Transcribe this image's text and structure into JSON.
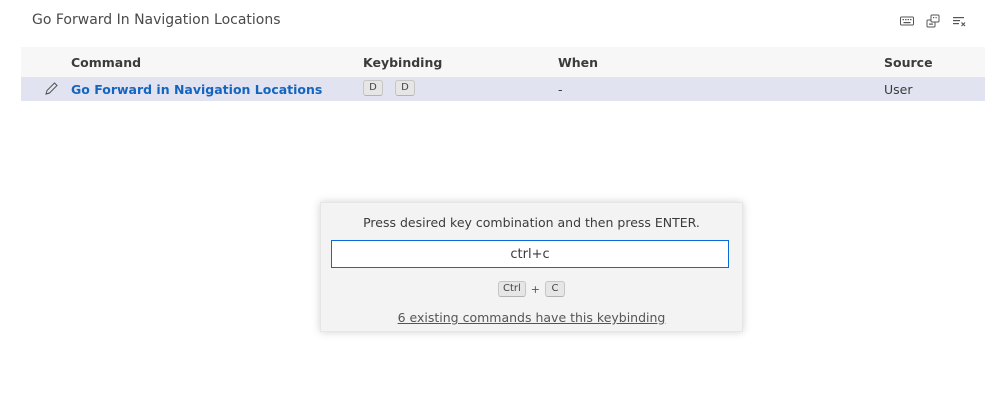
{
  "search": {
    "title": "Go Forward In Navigation Locations"
  },
  "header_actions": [
    {
      "icon": "keyboard-icon"
    },
    {
      "icon": "record-keys-icon"
    },
    {
      "icon": "clear-list-icon"
    }
  ],
  "table": {
    "headers": {
      "command": "Command",
      "keybinding": "Keybinding",
      "when": "When",
      "source": "Source"
    },
    "rows": [
      {
        "command": "Go Forward in Navigation Locations",
        "keys": [
          "D",
          "D"
        ],
        "when": "-",
        "source": "User"
      }
    ]
  },
  "dialog": {
    "message": "Press desired key combination and then press ENTER.",
    "input_value": "ctrl+c",
    "combo_keys": [
      "Ctrl",
      "C"
    ],
    "combo_separator": "+",
    "conflict_link": "6 existing commands have this keybinding"
  },
  "colors": {
    "accent": "#1565c0",
    "row_selected": "#e1e4f0",
    "input_border": "#0969da"
  }
}
